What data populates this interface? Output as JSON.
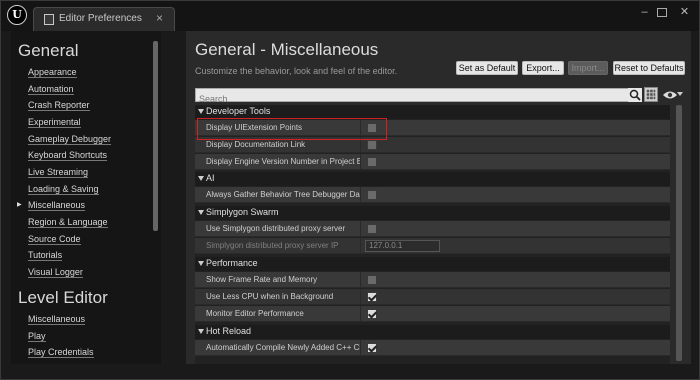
{
  "window": {
    "tab_title": "Editor Preferences",
    "tab_close": "×",
    "logo_text": "U",
    "min_label": "–",
    "max_label": "",
    "close_label": "✕"
  },
  "left": {
    "sections": [
      {
        "title": "General",
        "items": [
          "Appearance",
          "Automation",
          "Crash Reporter",
          "Experimental",
          "Gameplay Debugger",
          "Keyboard Shortcuts",
          "Live Streaming",
          "Loading & Saving",
          "Miscellaneous",
          "Region & Language",
          "Source Code",
          "Tutorials",
          "Visual Logger"
        ]
      },
      {
        "title": "Level Editor",
        "items": [
          "Miscellaneous",
          "Play",
          "Play Credentials"
        ]
      }
    ],
    "selected_item": "Miscellaneous"
  },
  "main": {
    "title": "General - Miscellaneous",
    "subtitle": "Customize the behavior, look and feel of the editor.",
    "buttons": {
      "set_default": "Set as Default",
      "export": "Export...",
      "import": "Import...",
      "reset": "Reset to Defaults"
    },
    "search_placeholder": "Search"
  },
  "categories": [
    {
      "label": "Developer Tools",
      "rows": [
        {
          "label": "Display UIExtension Points",
          "checked": false
        },
        {
          "label": "Display Documentation Link",
          "checked": false
        },
        {
          "label": "Display Engine Version Number in Project Ba",
          "checked": false
        }
      ]
    },
    {
      "label": "AI",
      "rows": [
        {
          "label": "Always Gather Behavior Tree Debugger Data",
          "checked": false
        }
      ]
    },
    {
      "label": "Simplygon Swarm",
      "rows": [
        {
          "label": "Use Simplygon distributed proxy server",
          "checked": false
        },
        {
          "label": "Simplygon distributed proxy server IP",
          "value": "127.0.0.1"
        }
      ]
    },
    {
      "label": "Performance",
      "rows": [
        {
          "label": "Show Frame Rate and Memory",
          "checked": false
        },
        {
          "label": "Use Less CPU when in Background",
          "checked": true
        },
        {
          "label": "Monitor Editor Performance",
          "checked": true
        }
      ]
    },
    {
      "label": "Hot Reload",
      "rows": [
        {
          "label": "Automatically Compile Newly Added C++ Cla",
          "checked": true
        }
      ]
    }
  ]
}
